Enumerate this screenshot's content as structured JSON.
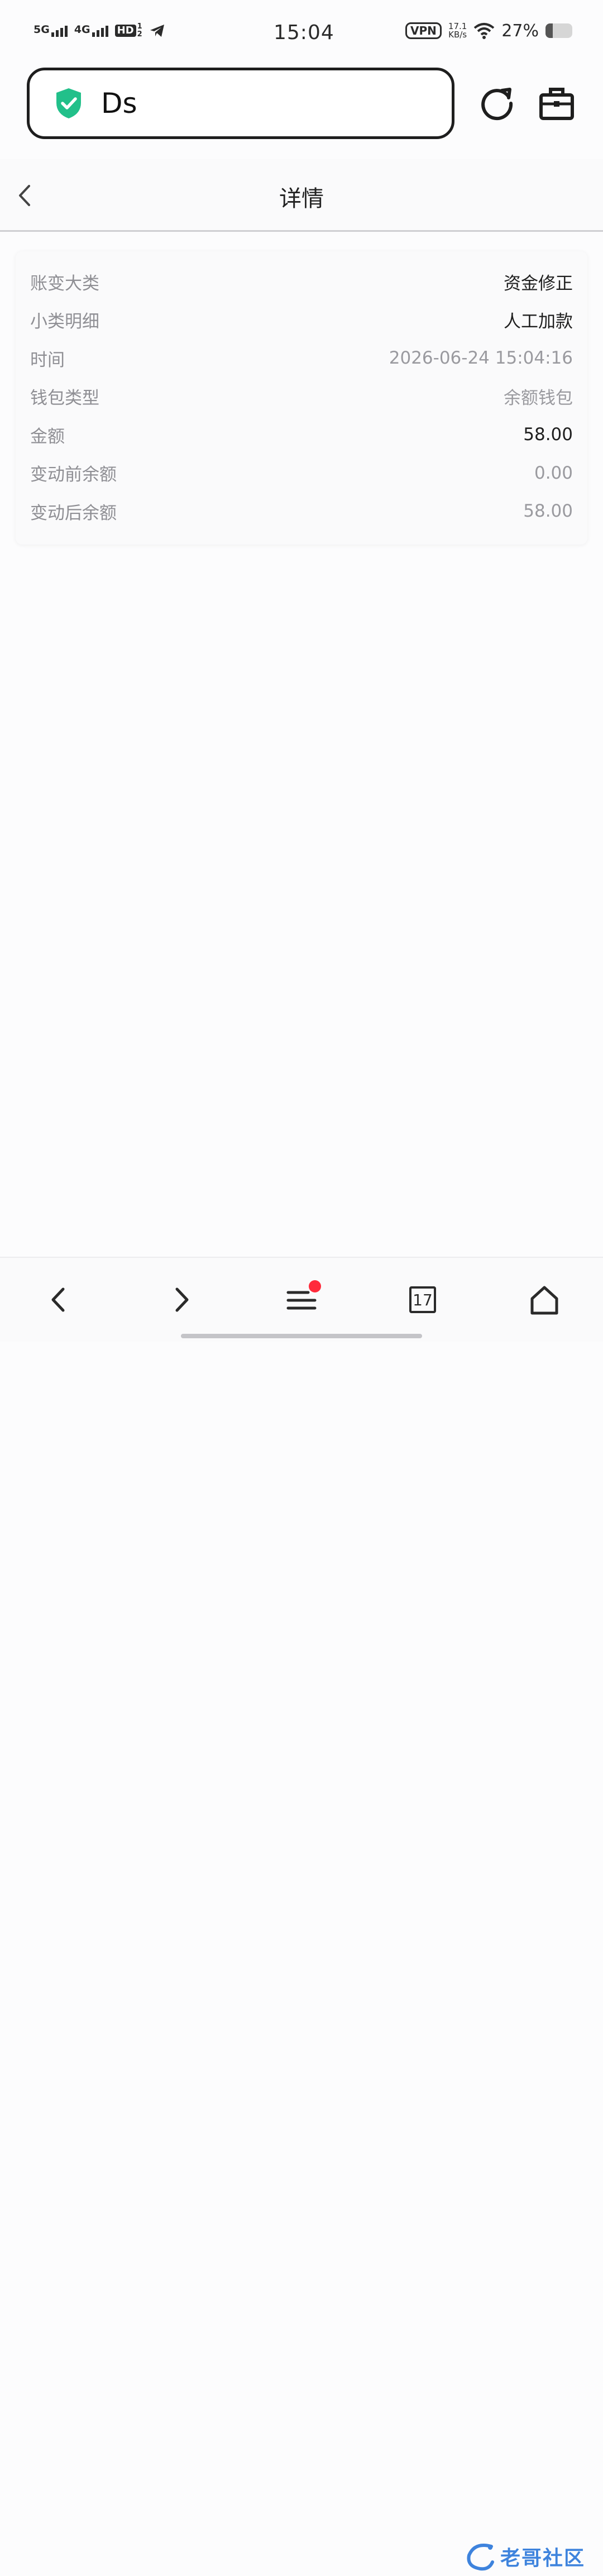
{
  "status_bar": {
    "network1": "5G",
    "network2": "4G",
    "hd_label": "HD",
    "hd_sub_top": "1",
    "hd_sub_bottom": "2",
    "time": "15:04",
    "vpn_label": "VPN",
    "speed_value": "17.1",
    "speed_unit": "KB/s",
    "battery_percent": "27%",
    "battery_level": 0.27
  },
  "browser": {
    "url_text": "Ds"
  },
  "page": {
    "title": "详情"
  },
  "details": [
    {
      "label": "账变大类",
      "value": "资金修正",
      "emphasis": true
    },
    {
      "label": "小类明细",
      "value": "人工加款",
      "emphasis": true
    },
    {
      "label": "时间",
      "value": "2026-06-24 15:04:16",
      "emphasis": false
    },
    {
      "label": "钱包类型",
      "value": "余额钱包",
      "emphasis": false
    },
    {
      "label": "金额",
      "value": "58.00",
      "emphasis": true
    },
    {
      "label": "变动前余额",
      "value": "0.00",
      "emphasis": false
    },
    {
      "label": "变动后余额",
      "value": "58.00",
      "emphasis": false
    }
  ],
  "bottom_nav": {
    "tab_count": "17"
  },
  "watermark": {
    "text": "老哥社区"
  },
  "colors": {
    "shield_green": "#22c08a",
    "notification_red": "#ff2a3b",
    "watermark_blue": "#1d6fd8"
  }
}
